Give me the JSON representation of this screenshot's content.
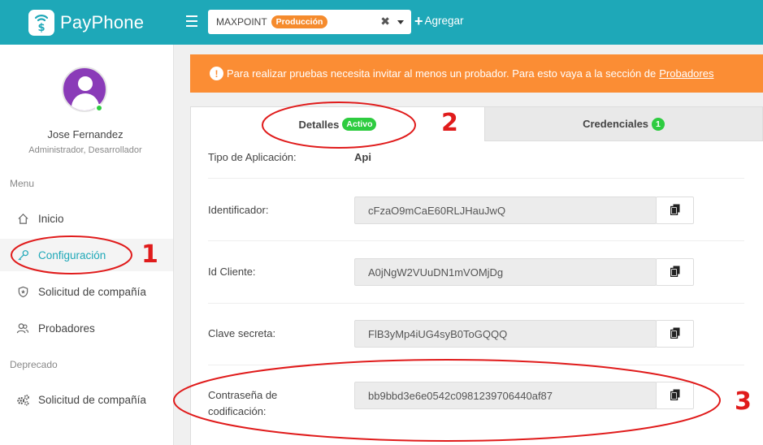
{
  "brand": {
    "name": "PayPhone"
  },
  "header": {
    "company_name": "MAXPOINT",
    "environment_badge": "Producción",
    "add_label": "Agregar"
  },
  "user": {
    "name": "Jose Fernandez",
    "role": "Administrador, Desarrollador",
    "status_color": "#2ecc40"
  },
  "sidebar": {
    "menu_label": "Menu",
    "deprecated_label": "Deprecado",
    "items": [
      {
        "label": "Inicio",
        "icon": "home-icon"
      },
      {
        "label": "Configuración",
        "icon": "key-icon",
        "active": true
      },
      {
        "label": "Solicitud de compañía",
        "icon": "shield-icon"
      },
      {
        "label": "Probadores",
        "icon": "users-icon"
      }
    ],
    "deprecated_items": [
      {
        "label": "Solicitud de compañía",
        "icon": "gears-icon"
      }
    ]
  },
  "alert": {
    "text": "Para realizar pruebas necesita invitar al menos un probador. Para esto vaya a la sección de",
    "link": "Probadores",
    "color": "#fb8d34"
  },
  "tabs": [
    {
      "label": "Detalles",
      "badge": "Activo",
      "active": true
    },
    {
      "label": "Credenciales",
      "badge": "1",
      "active": false
    }
  ],
  "details": {
    "app_type_label": "Tipo de Aplicación:",
    "app_type_value": "Api",
    "identifier_label": "Identificador:",
    "identifier_value": "cFzaO9mCaE60RLJHauJwQ",
    "client_id_label": "Id Cliente:",
    "client_id_value": "A0jNgW2VUuDN1mVOMjDg",
    "secret_label": "Clave secreta:",
    "secret_value": "FlB3yMp4iUG4syB0ToGQQQ",
    "encoding_password_label_1": "Contraseña de",
    "encoding_password_label_2": "codificación:",
    "encoding_password_value": "bb9bbd3e6e0542c0981239706440af87"
  },
  "annotations": [
    "1",
    "2",
    "3"
  ],
  "colors": {
    "primary": "#1ea8b8",
    "annotation": "#e01b1b"
  }
}
